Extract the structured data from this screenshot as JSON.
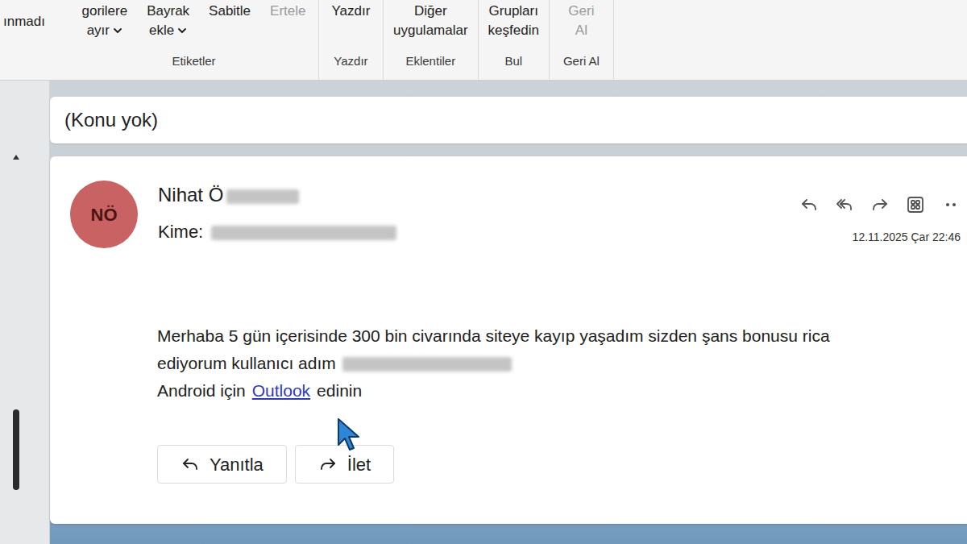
{
  "ribbon": {
    "leading": "ınmadı",
    "groups": [
      {
        "label": "Etiketler",
        "buttons": [
          {
            "lines": [
              "gorilere",
              "ayır"
            ],
            "kind": "menu",
            "disabled": false
          },
          {
            "lines": [
              "Bayrak",
              "ekle"
            ],
            "kind": "menu",
            "disabled": false
          },
          {
            "lines": [
              "Sabitle"
            ],
            "kind": "button",
            "disabled": false
          },
          {
            "lines": [
              "Ertele"
            ],
            "kind": "button",
            "disabled": true
          }
        ]
      },
      {
        "label": "Yazdır",
        "buttons": [
          {
            "lines": [
              "Yazdır"
            ],
            "kind": "button",
            "disabled": false
          }
        ]
      },
      {
        "label": "Eklentiler",
        "buttons": [
          {
            "lines": [
              "Diğer",
              "uygulamalar"
            ],
            "kind": "button",
            "disabled": false
          }
        ]
      },
      {
        "label": "Bul",
        "buttons": [
          {
            "lines": [
              "Grupları",
              "keşfedin"
            ],
            "kind": "button",
            "disabled": false
          }
        ]
      },
      {
        "label": "Geri Al",
        "buttons": [
          {
            "lines": [
              "Geri",
              "Al"
            ],
            "kind": "button",
            "disabled": true
          }
        ]
      }
    ]
  },
  "subject": "(Konu yok)",
  "message": {
    "avatar": "NÖ",
    "sender": "Nihat Ö",
    "to_label": "Kime:",
    "date": "12.11.2025 Çar 22:46",
    "body": [
      "Merhaba 5 gün içerisinde 300 bin civarında siteye kayıp yaşadım sizden şans bonusu rica",
      "ediyorum kullanıcı adım"
    ],
    "signature_prefix": "Android için",
    "signature_link": "Outlook",
    "signature_suffix": "edinin"
  },
  "reply_buttons": [
    {
      "label": "Yanıtla",
      "kind": "reply"
    },
    {
      "label": "İlet",
      "kind": "forward"
    }
  ]
}
